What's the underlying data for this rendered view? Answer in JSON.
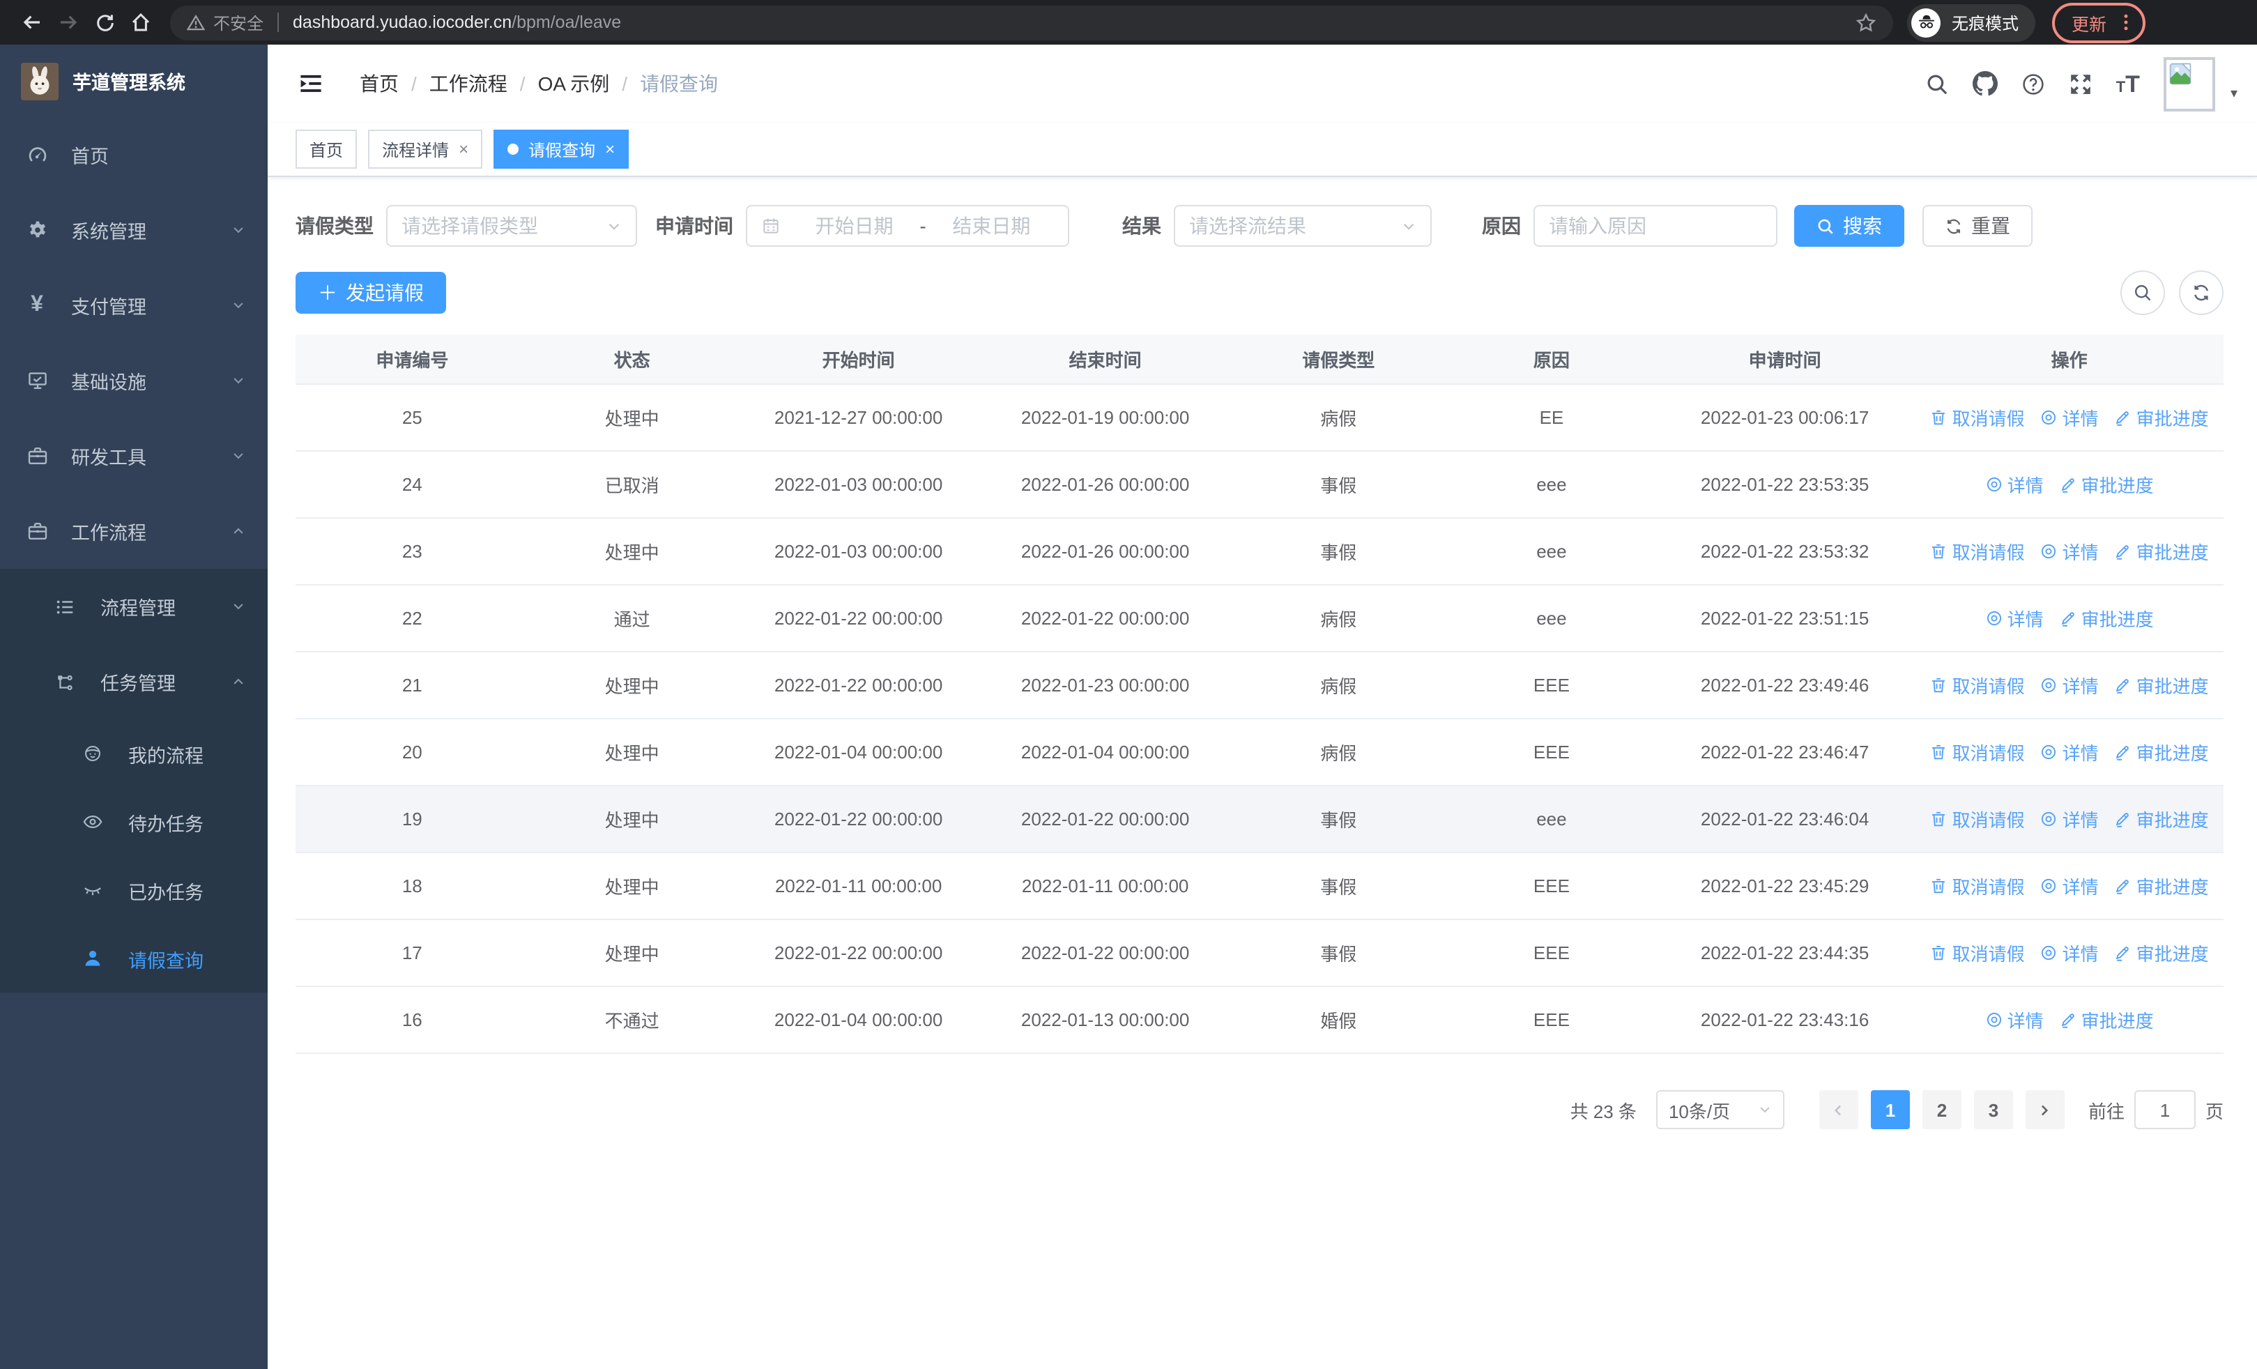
{
  "browser": {
    "not_secure_label": "不安全",
    "url_host": "dashboard.yudao.iocoder.cn",
    "url_path": "/bpm/oa/leave",
    "incognito_label": "无痕模式",
    "update_label": "更新"
  },
  "glyphs": {
    "close": "×",
    "plus": "＋",
    "yen": "¥",
    "caret_down": "▾",
    "t_small": "T",
    "t_large": "T",
    "date_dash": "-"
  },
  "sidebar": {
    "title": "芋道管理系统",
    "items": [
      {
        "label": "首页"
      },
      {
        "label": "系统管理"
      },
      {
        "label": "支付管理"
      },
      {
        "label": "基础设施"
      },
      {
        "label": "研发工具"
      },
      {
        "label": "工作流程"
      }
    ],
    "submenu": [
      {
        "label": "流程管理"
      },
      {
        "label": "任务管理"
      },
      {
        "label": "我的流程"
      },
      {
        "label": "待办任务"
      },
      {
        "label": "已办任务"
      },
      {
        "label": "请假查询"
      }
    ]
  },
  "breadcrumb": [
    "首页",
    "工作流程",
    "OA 示例",
    "请假查询"
  ],
  "breadcrumb_separator": "/",
  "tabs": [
    {
      "label": "首页"
    },
    {
      "label": "流程详情"
    },
    {
      "label": "请假查询"
    }
  ],
  "filters": {
    "leave_type_label": "请假类型",
    "leave_type_placeholder": "请选择请假类型",
    "apply_time_label": "申请时间",
    "date_start_placeholder": "开始日期",
    "date_end_placeholder": "结束日期",
    "result_label": "结果",
    "result_placeholder": "请选择流结果",
    "reason_label": "原因",
    "reason_placeholder": "请输入原因",
    "search_label": "搜索",
    "reset_label": "重置"
  },
  "toolbar": {
    "create_label": "发起请假"
  },
  "table": {
    "headers": [
      "申请编号",
      "状态",
      "开始时间",
      "结束时间",
      "请假类型",
      "原因",
      "申请时间",
      "操作"
    ],
    "action_labels": {
      "cancel": "取消请假",
      "detail": "详情",
      "progress": "审批进度"
    },
    "rows": [
      {
        "id": "25",
        "status": "处理中",
        "start_time": "2021-12-27 00:00:00",
        "end_time": "2022-01-19 00:00:00",
        "leave_type": "病假",
        "reason": "EE",
        "apply_time": "2022-01-23 00:06:17",
        "actions": [
          "cancel",
          "detail",
          "progress"
        ]
      },
      {
        "id": "24",
        "status": "已取消",
        "start_time": "2022-01-03 00:00:00",
        "end_time": "2022-01-26 00:00:00",
        "leave_type": "事假",
        "reason": "eee",
        "apply_time": "2022-01-22 23:53:35",
        "actions": [
          "detail",
          "progress"
        ]
      },
      {
        "id": "23",
        "status": "处理中",
        "start_time": "2022-01-03 00:00:00",
        "end_time": "2022-01-26 00:00:00",
        "leave_type": "事假",
        "reason": "eee",
        "apply_time": "2022-01-22 23:53:32",
        "actions": [
          "cancel",
          "detail",
          "progress"
        ]
      },
      {
        "id": "22",
        "status": "通过",
        "start_time": "2022-01-22 00:00:00",
        "end_time": "2022-01-22 00:00:00",
        "leave_type": "病假",
        "reason": "eee",
        "apply_time": "2022-01-22 23:51:15",
        "actions": [
          "detail",
          "progress"
        ]
      },
      {
        "id": "21",
        "status": "处理中",
        "start_time": "2022-01-22 00:00:00",
        "end_time": "2022-01-23 00:00:00",
        "leave_type": "病假",
        "reason": "EEE",
        "apply_time": "2022-01-22 23:49:46",
        "actions": [
          "cancel",
          "detail",
          "progress"
        ]
      },
      {
        "id": "20",
        "status": "处理中",
        "start_time": "2022-01-04 00:00:00",
        "end_time": "2022-01-04 00:00:00",
        "leave_type": "病假",
        "reason": "EEE",
        "apply_time": "2022-01-22 23:46:47",
        "actions": [
          "cancel",
          "detail",
          "progress"
        ]
      },
      {
        "id": "19",
        "status": "处理中",
        "start_time": "2022-01-22 00:00:00",
        "end_time": "2022-01-22 00:00:00",
        "leave_type": "事假",
        "reason": "eee",
        "apply_time": "2022-01-22 23:46:04",
        "actions": [
          "cancel",
          "detail",
          "progress"
        ],
        "highlighted": true
      },
      {
        "id": "18",
        "status": "处理中",
        "start_time": "2022-01-11 00:00:00",
        "end_time": "2022-01-11 00:00:00",
        "leave_type": "事假",
        "reason": "EEE",
        "apply_time": "2022-01-22 23:45:29",
        "actions": [
          "cancel",
          "detail",
          "progress"
        ]
      },
      {
        "id": "17",
        "status": "处理中",
        "start_time": "2022-01-22 00:00:00",
        "end_time": "2022-01-22 00:00:00",
        "leave_type": "事假",
        "reason": "EEE",
        "apply_time": "2022-01-22 23:44:35",
        "actions": [
          "cancel",
          "detail",
          "progress"
        ]
      },
      {
        "id": "16",
        "status": "不通过",
        "start_time": "2022-01-04 00:00:00",
        "end_time": "2022-01-13 00:00:00",
        "leave_type": "婚假",
        "reason": "EEE",
        "apply_time": "2022-01-22 23:43:16",
        "actions": [
          "detail",
          "progress"
        ]
      }
    ]
  },
  "pagination": {
    "total_label": "共 23 条",
    "page_size_label": "10条/页",
    "pages": [
      "1",
      "2",
      "3"
    ],
    "current_page": "1",
    "goto_label": "前往",
    "goto_value": "1",
    "goto_suffix": "页"
  },
  "colors": {
    "primary": "#409eff",
    "link": "#58a3f8",
    "sidebar_bg": "#324157",
    "submenu_bg": "#283848",
    "chrome_bg": "#202124",
    "update_accent": "#f28b82"
  }
}
